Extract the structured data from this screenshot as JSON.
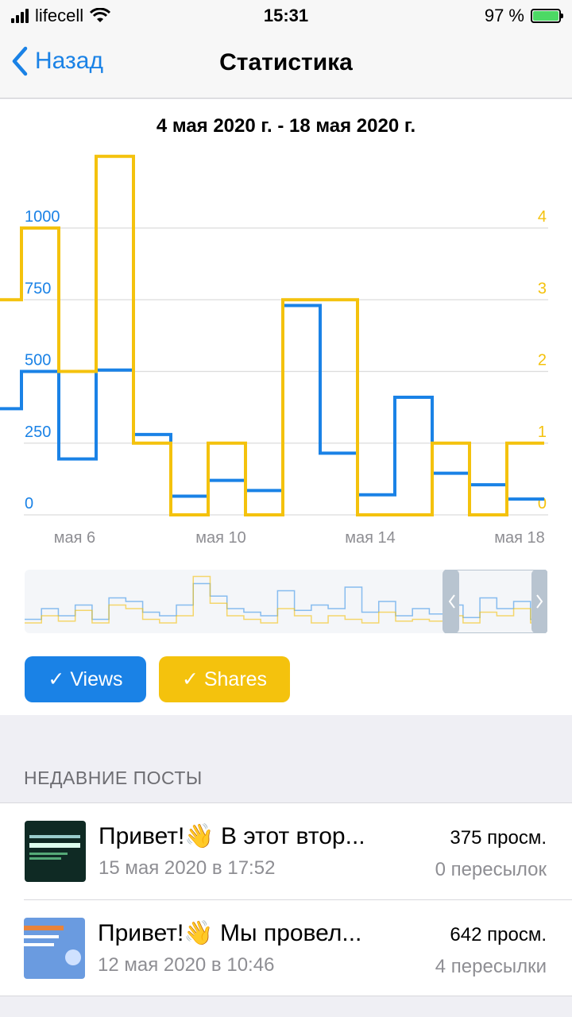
{
  "status_bar": {
    "carrier": "lifecell",
    "time": "15:31",
    "battery": "97 %"
  },
  "nav": {
    "back_label": "Назад",
    "title": "Статистика"
  },
  "stats": {
    "period": "4 мая 2020 г. - 18 мая 2020 г."
  },
  "chart_data": {
    "type": "line",
    "step": true,
    "x_ticks": [
      "мая 6",
      "мая 10",
      "мая 14",
      "мая 18"
    ],
    "y_left_ticks": [
      "0",
      "250",
      "500",
      "750",
      "1000"
    ],
    "y_right_ticks": [
      "0",
      "1",
      "2",
      "3",
      "4"
    ],
    "y_left_range": [
      0,
      1000
    ],
    "y_right_range": [
      0,
      4
    ],
    "grid": true,
    "series": [
      {
        "name": "Views",
        "color": "#1a82e6",
        "axis": "left",
        "values": [
          370,
          500,
          195,
          505,
          280,
          65,
          120,
          85,
          730,
          215,
          70,
          410,
          145,
          105,
          55
        ]
      },
      {
        "name": "Shares",
        "color": "#f4c20d",
        "axis": "right",
        "values": [
          3,
          4,
          2,
          5,
          1,
          0,
          1,
          0,
          3,
          3,
          0,
          0,
          1,
          0,
          1
        ]
      }
    ]
  },
  "legend": {
    "views_label": "✓ Views",
    "shares_label": "✓ Shares"
  },
  "recent": {
    "header": "НЕДАВНИЕ ПОСТЫ",
    "posts": [
      {
        "title": "Привет!👋  В этот втор...",
        "date": "15 мая 2020 в 17:52",
        "views": "375 просм.",
        "shares": "0 пересылок"
      },
      {
        "title": "Привет!👋  Мы провел...",
        "date": "12 мая 2020 в 10:46",
        "views": "642 просм.",
        "shares": "4 пересылки"
      }
    ]
  }
}
